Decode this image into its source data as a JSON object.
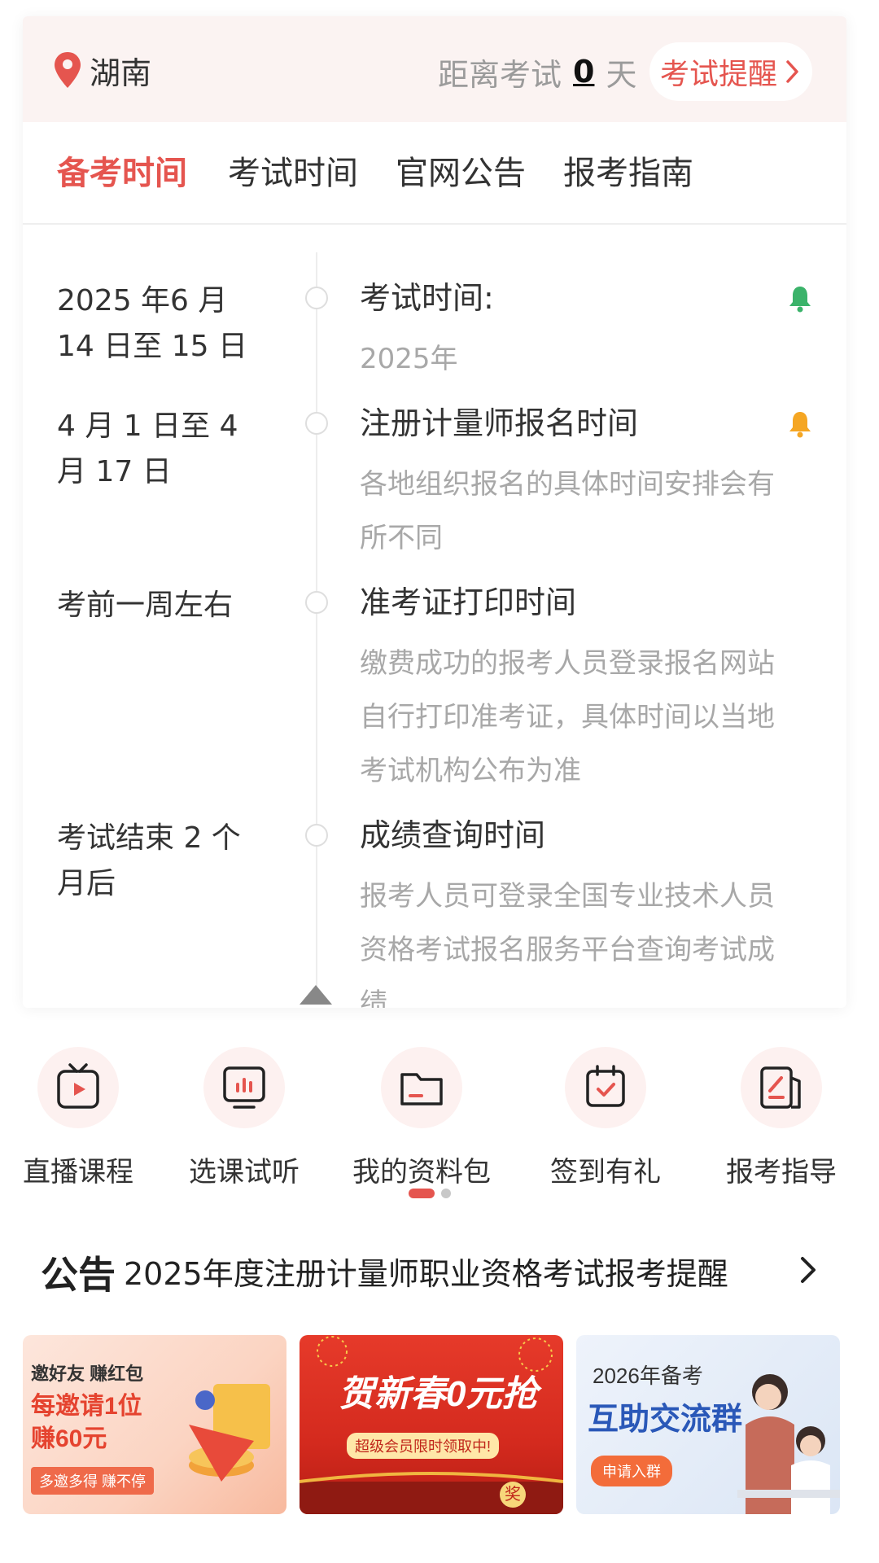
{
  "header": {
    "location": "湖南",
    "countdown_prefix": "距离考试",
    "countdown_value": "0",
    "countdown_suffix": "天",
    "reminder_label": "考试提醒"
  },
  "tabs": [
    {
      "label": "备考时间",
      "active": true
    },
    {
      "label": "考试时间",
      "active": false
    },
    {
      "label": "官网公告",
      "active": false
    },
    {
      "label": "报考指南",
      "active": false
    }
  ],
  "timeline": [
    {
      "date": "2025 年6 月 14 日至 15 日",
      "title": "考试时间:",
      "desc": "2025年",
      "bell": "green"
    },
    {
      "date": "4 月 1 日至 4 月 17 日",
      "title": "注册计量师报名时间",
      "desc": "各地组织报名的具体时间安排会有所不同",
      "bell": "orange"
    },
    {
      "date": "考前一周左右",
      "title": "准考证打印时间",
      "desc": "缴费成功的报考人员登录报名网站自行打印准考证，具体时间以当地考试机构公布为准",
      "bell": ""
    },
    {
      "date": "考试结束 2 个月后",
      "title": "成绩查询时间",
      "desc": "报考人员可登录全国专业技术人员资格考试报名服务平台查询考试成绩",
      "bell": ""
    }
  ],
  "quick_actions": [
    {
      "label": "直播课程",
      "icon": "live-tv-icon"
    },
    {
      "label": "选课试听",
      "icon": "chart-screen-icon"
    },
    {
      "label": "我的资料包",
      "icon": "folder-icon"
    },
    {
      "label": "签到有礼",
      "icon": "calendar-check-icon"
    },
    {
      "label": "报考指导",
      "icon": "document-pen-icon"
    }
  ],
  "notice": {
    "tag": "公告",
    "text": "2025年度注册计量师职业资格考试报考提醒"
  },
  "banners": {
    "invite": {
      "line1": "邀好友 赚红包",
      "line2": "每邀请1位",
      "line3": "赚60元",
      "line4": "多邀多得 赚不停"
    },
    "newyear": {
      "line1": "贺新春0元抢",
      "line2": "超级会员限时领取中!",
      "badge": "奖"
    },
    "group": {
      "line1": "2026年备考",
      "line2": "互助交流群",
      "line3": "申请入群"
    }
  },
  "colors": {
    "accent": "#e5554f",
    "bell_green": "#3bb36a",
    "bell_orange": "#f5a623"
  }
}
